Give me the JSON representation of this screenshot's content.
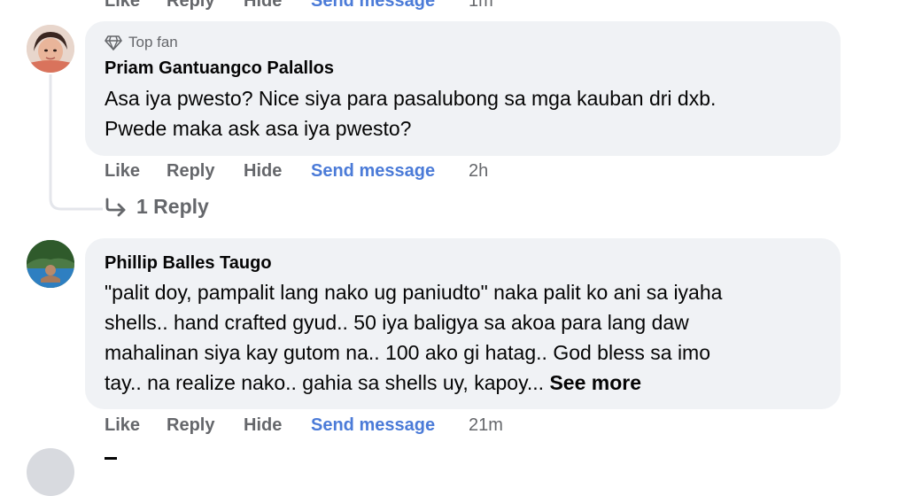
{
  "top_actions": {
    "like": "Like",
    "reply": "Reply",
    "hide": "Hide",
    "send": "Send message",
    "time": "1m"
  },
  "comment1": {
    "badge": "Top fan",
    "author": "Priam Gantuangco Palallos",
    "lines": [
      "Asa iya pwesto? Nice siya para pasalubong sa mga kauban dri dxb.",
      "Pwede maka ask asa iya pwesto?"
    ],
    "actions": {
      "like": "Like",
      "reply": "Reply",
      "hide": "Hide",
      "send": "Send message",
      "time": "2h"
    },
    "replies_label": "1 Reply"
  },
  "comment2": {
    "author": "Phillip Balles Taugo",
    "lines": [
      "\"palit doy, pampalit lang nako ug paniudto\" naka palit ko ani sa iyaha",
      "shells.. hand crafted gyud.. 50 iya baligya sa akoa para lang daw",
      "mahalinan siya kay gutom na.. 100 ako gi hatag.. God bless sa imo",
      "tay.. na realize nako.. gahia sa shells uy, kapoy..."
    ],
    "see_more": "See more",
    "actions": {
      "like": "Like",
      "reply": "Reply",
      "hide": "Hide",
      "send": "Send message",
      "time": "21m"
    }
  },
  "colors": {
    "bubble": "#f0f2f5",
    "link": "#4b7bd8",
    "muted": "#65676b",
    "text": "#050505"
  },
  "icons": [
    "diamond-icon",
    "reply-arrow-icon"
  ]
}
